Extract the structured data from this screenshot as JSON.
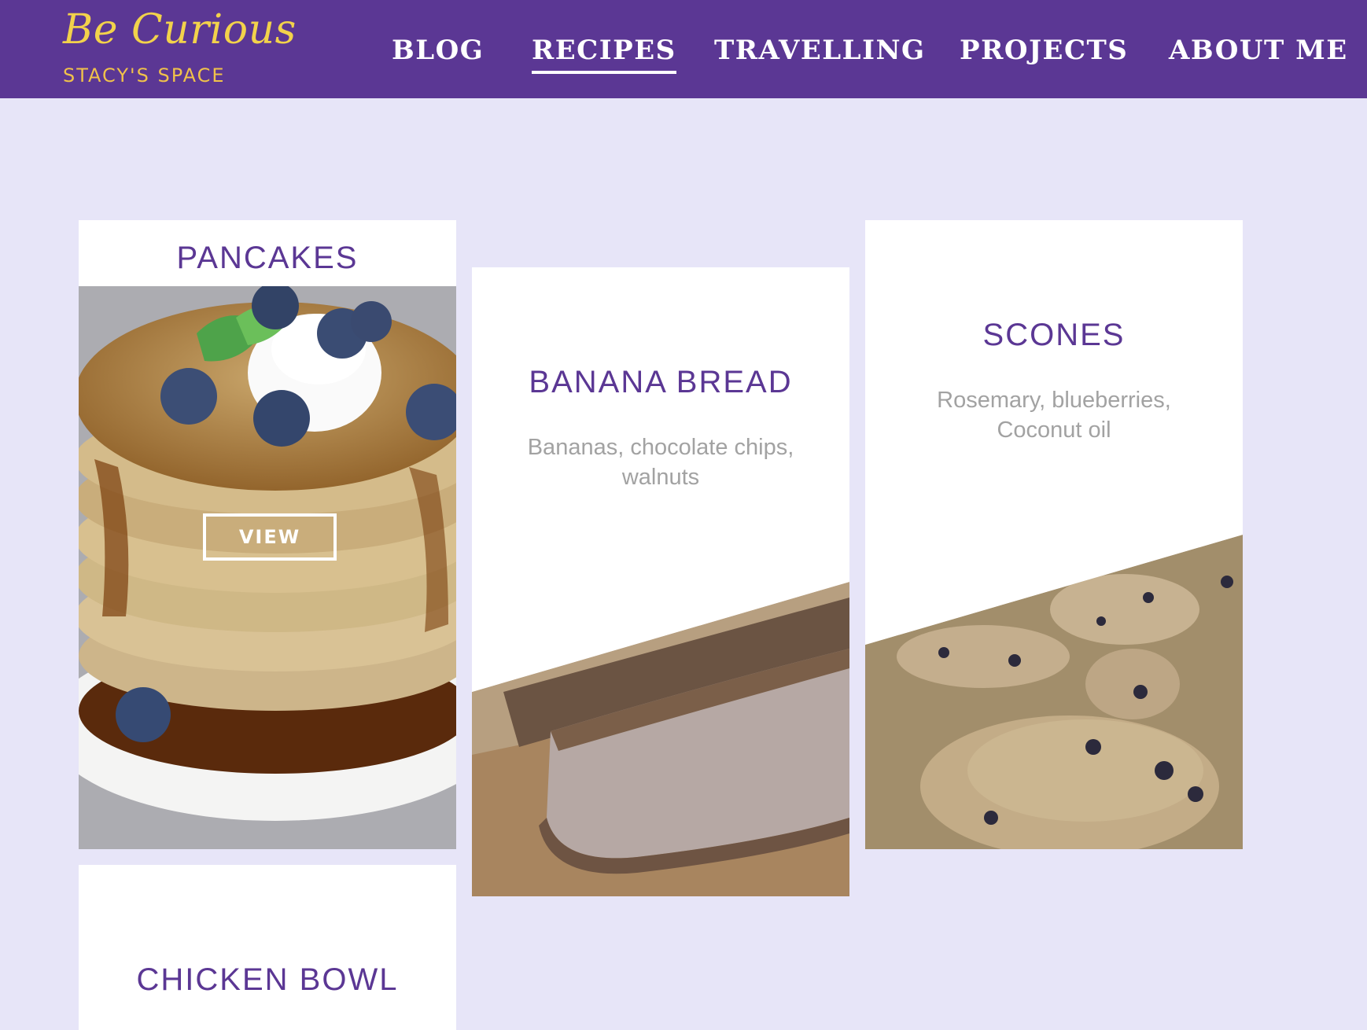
{
  "header": {
    "logo_title": "Be Curious",
    "logo_subtitle": "STACY'S SPACE",
    "nav": [
      {
        "label": "BLOG"
      },
      {
        "label": "RECIPES"
      },
      {
        "label": "TRAVELLING"
      },
      {
        "label": "PROJECTS"
      },
      {
        "label": "ABOUT ME"
      }
    ],
    "active_nav": "RECIPES"
  },
  "recipes": [
    {
      "title": "PANCAKES",
      "view_label": "VIEW"
    },
    {
      "title": "BANANA BREAD",
      "ingredients": "Bananas, chocolate chips, walnuts"
    },
    {
      "title": "SCONES",
      "ingredients": "Rosemary, blueberries, Coconut oil"
    },
    {
      "title": "CHICKEN BOWL"
    }
  ],
  "colors": {
    "header_bg": "#5b3794",
    "page_bg": "#e7e5f8",
    "logo": "#f2d24b",
    "card_title": "#5b3794",
    "card_text": "#a2a2a2"
  },
  "icons": [
    "pancake-photo",
    "banana-bread-photo",
    "scones-photo"
  ]
}
